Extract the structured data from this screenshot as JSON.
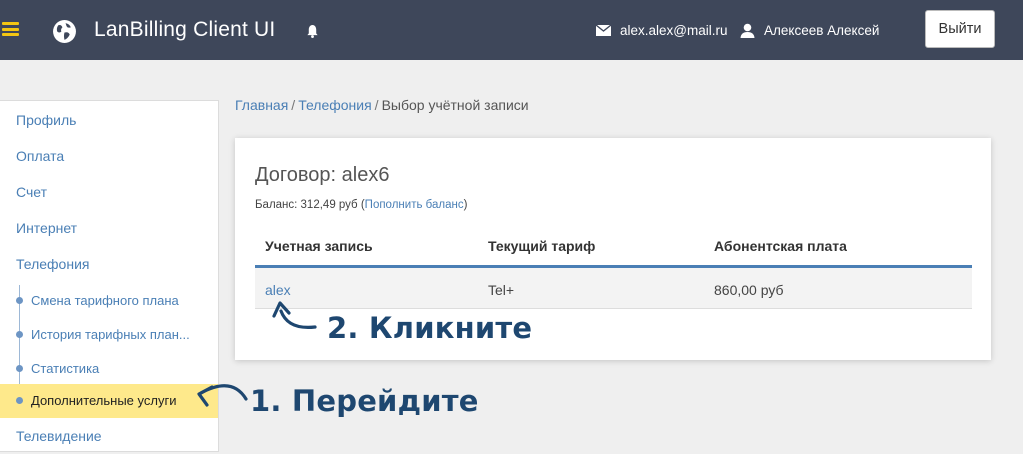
{
  "header": {
    "app_title": "LanBilling Client UI",
    "email": "alex.alex@mail.ru",
    "username": "Алексеев Алексей",
    "logout_label": "Выйти",
    "accent_color": "#f3c613",
    "bar_color": "#3e475a"
  },
  "sidebar": {
    "items": [
      {
        "label": "Профиль"
      },
      {
        "label": "Оплата"
      },
      {
        "label": "Счет"
      },
      {
        "label": "Интернет"
      },
      {
        "label": "Телефония"
      },
      {
        "label": "Смена тарифного плана"
      },
      {
        "label": "История тарифных план..."
      },
      {
        "label": "Статистика"
      },
      {
        "label": "Дополнительные услуги"
      },
      {
        "label": "Телевидение"
      }
    ],
    "active_item": "Дополнительные услуги"
  },
  "breadcrumb": {
    "home": "Главная",
    "section": "Телефония",
    "current": "Выбор учётной записи"
  },
  "contract": {
    "title": "Договор: alex6",
    "balance_text": "Баланс: 312,49  руб (",
    "topup_link": "Пополнить баланс",
    "balance_suffix": ")"
  },
  "table": {
    "headers": [
      "Учетная запись",
      "Текущий тариф",
      "Абонентская плата"
    ],
    "rows": [
      {
        "account": "alex",
        "tariff": "Tel+",
        "fee": "860,00 руб"
      }
    ]
  },
  "annotations": {
    "step1": "1. Перейдите",
    "step2": "2. Кликните",
    "color": "#1e4770"
  }
}
